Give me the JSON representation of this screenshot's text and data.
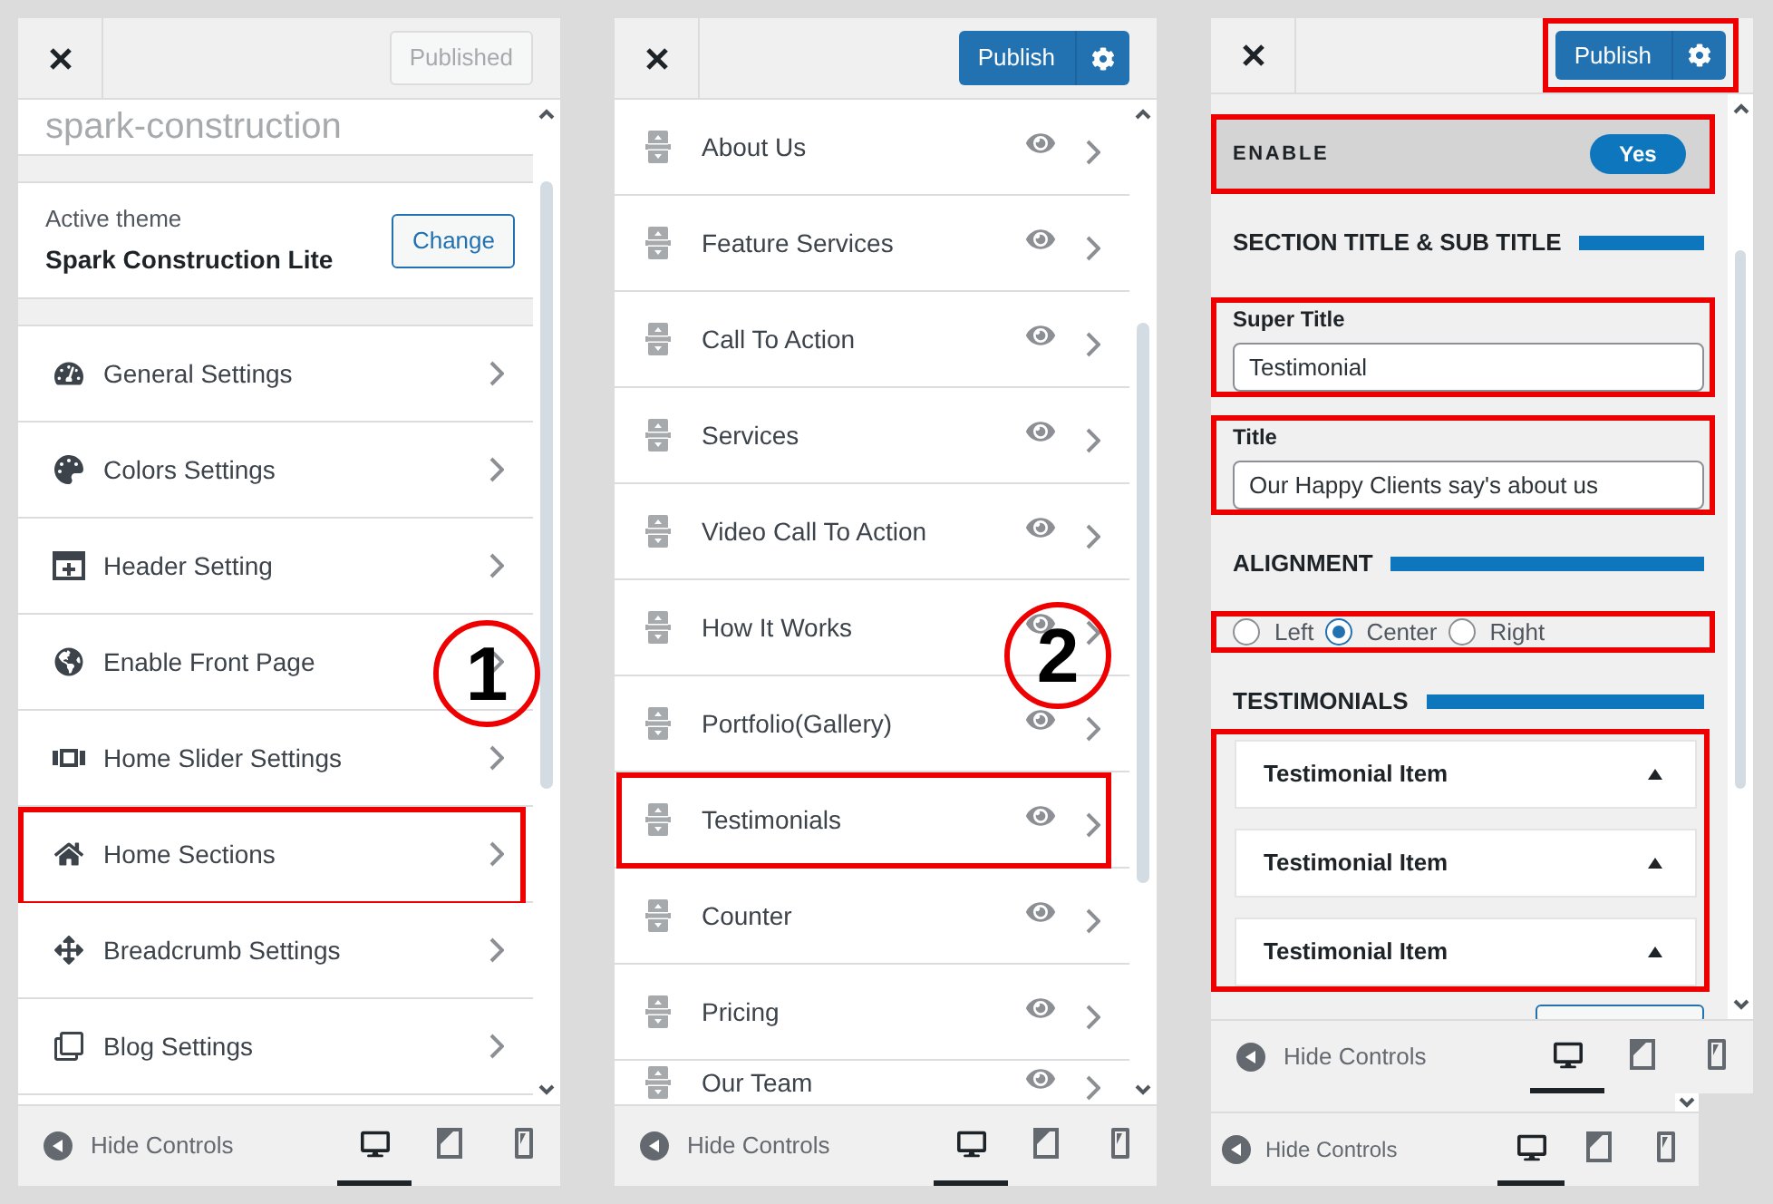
{
  "panels": [
    {
      "kind": "menu",
      "header": {
        "button": {
          "label": "Published",
          "disabled": true,
          "highlighted": false
        }
      },
      "site_title": "spark-construction",
      "active_theme": {
        "label": "Active theme",
        "name": "Spark Construction Lite",
        "button": "Change"
      },
      "items": [
        {
          "label": "General Settings",
          "highlighted": false
        },
        {
          "label": "Colors Settings",
          "highlighted": false
        },
        {
          "label": "Header Setting",
          "highlighted": false
        },
        {
          "label": "Enable Front Page",
          "highlighted": false
        },
        {
          "label": "Home Slider Settings",
          "highlighted": false
        },
        {
          "label": "Home Sections",
          "highlighted": true
        },
        {
          "label": "Breadcrumb Settings",
          "highlighted": false
        },
        {
          "label": "Blog Settings",
          "highlighted": false
        }
      ],
      "callout": "1",
      "footers": [
        {
          "label": "Hide Controls",
          "devices": [
            {
              "selected": true
            },
            {
              "selected": false
            },
            {
              "selected": false
            }
          ]
        }
      ]
    },
    {
      "kind": "sections",
      "header": {
        "button": {
          "label": "Publish",
          "disabled": false,
          "highlighted": false
        }
      },
      "items": [
        {
          "label": "About Us",
          "highlighted": false
        },
        {
          "label": "Feature Services",
          "highlighted": false
        },
        {
          "label": "Call To Action",
          "highlighted": false
        },
        {
          "label": "Services",
          "highlighted": false
        },
        {
          "label": "Video Call To Action",
          "highlighted": false
        },
        {
          "label": "How It Works",
          "highlighted": false
        },
        {
          "label": "Portfolio(Gallery)",
          "highlighted": false
        },
        {
          "label": "Testimonials",
          "highlighted": true
        },
        {
          "label": "Counter",
          "highlighted": false
        },
        {
          "label": "Pricing",
          "highlighted": false
        },
        {
          "label": "Our Team",
          "highlighted": false
        }
      ],
      "callout": "2",
      "footers": [
        {
          "label": "Hide Controls",
          "devices": [
            {
              "selected": true
            },
            {
              "selected": false
            },
            {
              "selected": false
            }
          ]
        }
      ]
    },
    {
      "kind": "form",
      "header": {
        "button": {
          "label": "Publish",
          "disabled": false,
          "highlighted": true
        }
      },
      "enable": {
        "label": "ENABLE",
        "toggle": "Yes",
        "on": true,
        "highlighted": true
      },
      "sections": [
        {
          "kind": "heading",
          "label": "SECTION TITLE & SUB TITLE"
        },
        {
          "kind": "text_field",
          "label": "Super Title",
          "value": "Testimonial",
          "highlighted": true
        },
        {
          "kind": "text_field",
          "label": "Title",
          "value": "Our Happy Clients say's about us",
          "highlighted": true
        },
        {
          "kind": "heading",
          "label": "ALIGNMENT"
        },
        {
          "kind": "radio_group",
          "highlighted": true,
          "options": [
            {
              "label": "Left",
              "selected": false
            },
            {
              "label": "Center",
              "selected": true
            },
            {
              "label": "Right",
              "selected": false
            }
          ]
        },
        {
          "kind": "heading",
          "label": "TESTIMONIALS"
        },
        {
          "kind": "repeater",
          "highlighted": true,
          "items": [
            {
              "label": "Testimonial Item"
            },
            {
              "label": "Testimonial Item"
            },
            {
              "label": "Testimonial Item"
            }
          ]
        }
      ],
      "footers": [
        {
          "label": "Hide Controls",
          "devices": [
            {
              "selected": true
            },
            {
              "selected": false
            },
            {
              "selected": false
            }
          ]
        },
        {
          "label": "Hide Controls",
          "devices": [
            {
              "selected": true
            },
            {
              "selected": false
            },
            {
              "selected": false
            }
          ]
        }
      ]
    }
  ]
}
